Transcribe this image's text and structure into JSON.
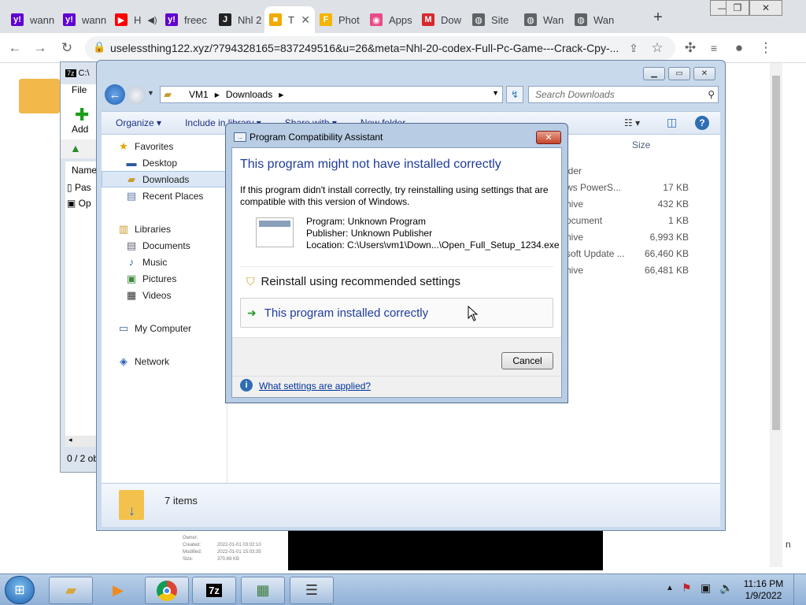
{
  "browser": {
    "tabs": [
      {
        "label": "wann",
        "favicon": "yahoo-icon",
        "color": "#6001d2",
        "glyph": "y!"
      },
      {
        "label": "wann",
        "favicon": "yahoo-icon",
        "color": "#6001d2",
        "glyph": "y!"
      },
      {
        "label": "H",
        "favicon": "youtube-icon",
        "color": "#ff0000",
        "glyph": "▶"
      },
      {
        "label": "freec",
        "favicon": "yahoo-icon",
        "color": "#6001d2",
        "glyph": "y!"
      },
      {
        "label": "Nhl 2",
        "favicon": "joy-icon",
        "color": "#222222",
        "glyph": "J"
      },
      {
        "label": "T",
        "favicon": "folder-icon",
        "color": "#f2a900",
        "glyph": "■"
      },
      {
        "label": "Phot",
        "favicon": "photo-icon",
        "color": "#f4b400",
        "glyph": "F"
      },
      {
        "label": "Apps",
        "favicon": "apps-icon",
        "color": "#e94a8a",
        "glyph": "◉"
      },
      {
        "label": "Dow",
        "favicon": "mega-icon",
        "color": "#d9272e",
        "glyph": "M"
      },
      {
        "label": "Site",
        "favicon": "globe-icon",
        "color": "#5f6368",
        "glyph": "◍"
      },
      {
        "label": "Wan",
        "favicon": "globe-icon",
        "color": "#5f6368",
        "glyph": "◍"
      },
      {
        "label": "Wan",
        "favicon": "globe-icon",
        "color": "#5f6368",
        "glyph": "◍"
      }
    ],
    "new_tab": "+",
    "url": "uselessthing122.xyz/?794328165=837249516&u=26&meta=Nhl-20-codex-Full-Pc-Game---Crack-Cpy-..."
  },
  "explorer": {
    "breadcrumb": [
      "VM1",
      "Downloads"
    ],
    "search_placeholder": "Search Downloads",
    "commands": [
      "Organize ▾",
      "Include in library ▾",
      "Share with ▾",
      "New folder"
    ],
    "column_size": "Size",
    "nav": {
      "favorites": "Favorites",
      "desktop": "Desktop",
      "downloads": "Downloads",
      "recent": "Recent Places",
      "libraries": "Libraries",
      "documents": "Documents",
      "music": "Music",
      "pictures": "Pictures",
      "videos": "Videos",
      "computer": "My Computer",
      "network": "Network"
    },
    "rows": [
      {
        "type": "lder",
        "size": ""
      },
      {
        "type": "ws PowerS...",
        "size": "17 KB"
      },
      {
        "type": "hive",
        "size": "432 KB"
      },
      {
        "type": "ocument",
        "size": "1 KB"
      },
      {
        "type": "hive",
        "size": "6,993 KB"
      },
      {
        "type": "soft Update ...",
        "size": "66,460 KB"
      },
      {
        "type": "hive",
        "size": "66,481 KB"
      }
    ],
    "items_count": "7 items"
  },
  "zip": {
    "title": "C:\\",
    "menu_file": "File",
    "add": "Add",
    "col_name": "Name",
    "row1": "Pas",
    "row2": "Op",
    "status": "0 / 2 ob"
  },
  "dialog": {
    "title": "Program Compatibility Assistant",
    "heading": "This program might not have installed correctly",
    "message": "If this program didn't install correctly, try reinstalling using settings that are compatible with this version of Windows.",
    "program": "Program: Unknown Program",
    "publisher": "Publisher: Unknown Publisher",
    "location": "Location: C:\\Users\\vm1\\Down...\\Open_Full_Setup_1234.exe",
    "option_reinstall": "Reinstall using recommended settings",
    "option_correct": "This program installed correctly",
    "cancel": "Cancel",
    "settings_link": "What settings are applied?"
  },
  "thumbs": {
    "owner": "Owner:",
    "created": "Created:",
    "created_val": "2022-01-01 03:02:10",
    "modified": "Modified:",
    "modified_val": "2022-01-01 15:03:35",
    "size": "Size:",
    "size_val": "370.69 KB"
  },
  "taskbar": {
    "time": "11:16 PM",
    "date": "1/9/2022",
    "edge_letter": "n"
  },
  "colors": {
    "link_blue": "#003399",
    "dialog_heading": "#1e3c9b",
    "chrome_tab_bg": "#dee1e6"
  }
}
